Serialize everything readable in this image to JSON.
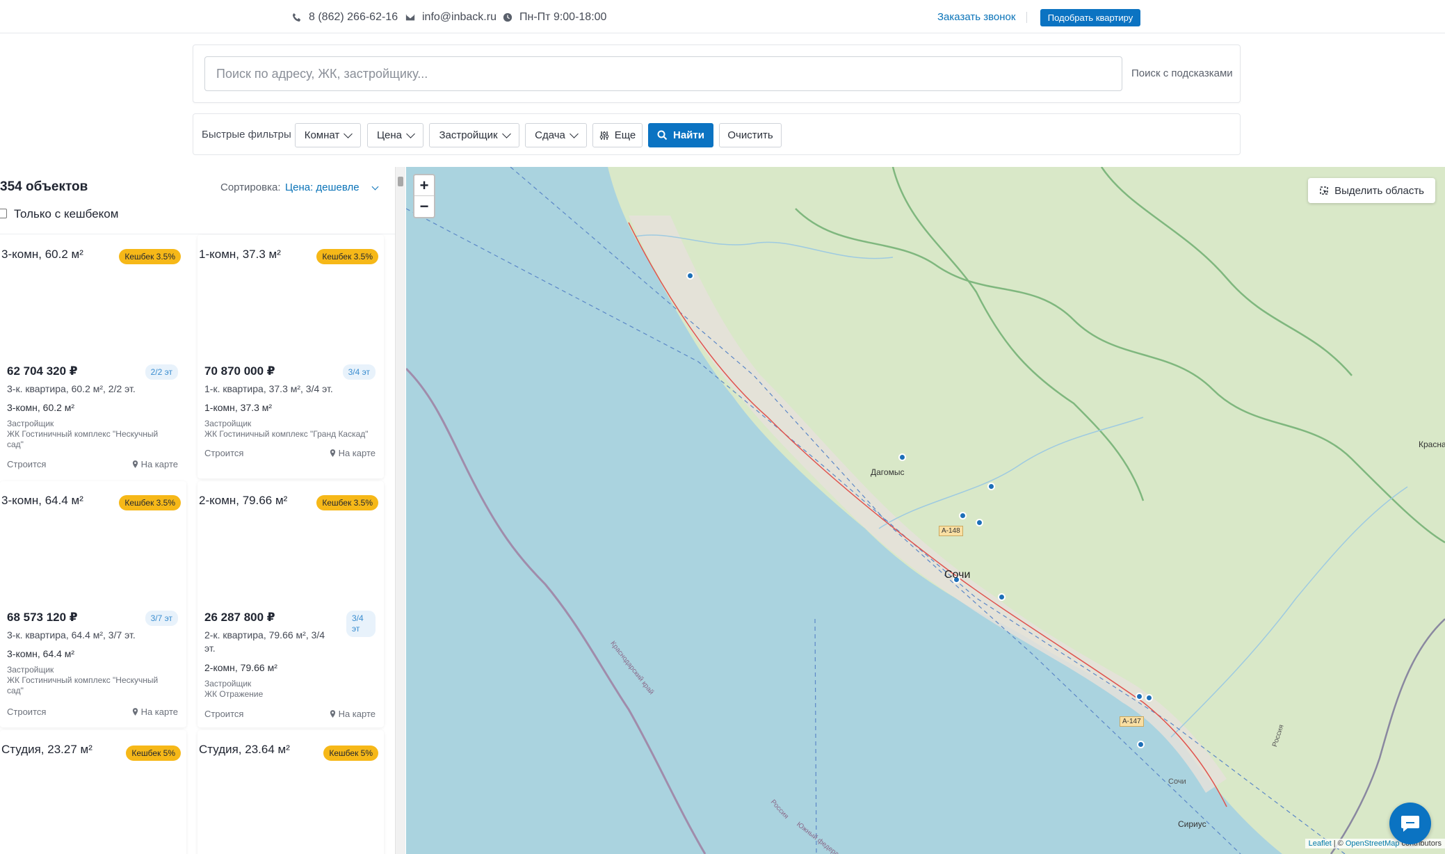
{
  "topbar": {
    "phone": "8 (862) 266-62-16",
    "email": "info@inback.ru",
    "hours": "Пн-Пт 9:00-18:00",
    "callback": "Заказать звонок",
    "cta": "Подобрать квартиру"
  },
  "search": {
    "placeholder": "Поиск по адресу, ЖК, застройщику...",
    "hint": "Поиск с подсказками"
  },
  "filters": {
    "label": "Быстрые фильтры",
    "rooms": "Комнат",
    "price": "Цена",
    "developer": "Застройщик",
    "delivery": "Сдача",
    "more": "Еще",
    "find": "Найти",
    "clear": "Очистить"
  },
  "list": {
    "count": "354 объектов",
    "sort_label": "Сортировка:",
    "sort_value": "Цена: дешевле",
    "cashback_only": "Только с кешбеком",
    "on_map": "На карте",
    "developer_label": "Застройщик",
    "cards": [
      {
        "title": "3-комн, 60.2 м²",
        "badge": "Кешбек 3.5%",
        "price": "62 704 320 ₽",
        "floor": "2/2 эт",
        "desc": "3-к. квартира, 60.2 м², 2/2 эт.",
        "sub": "3-комн, 60.2 м²",
        "complex": "ЖК Гостиничный комплекс \"Нескучный сад\"",
        "status": "Строится"
      },
      {
        "title": "1-комн, 37.3 м²",
        "badge": "Кешбек 3.5%",
        "price": "70 870 000 ₽",
        "floor": "3/4 эт",
        "desc": "1-к. квартира, 37.3 м², 3/4 эт.",
        "sub": "1-комн, 37.3 м²",
        "complex": "ЖК Гостиничный комплекс \"Гранд Каскад\"",
        "status": "Строится"
      },
      {
        "title": "3-комн, 64.4 м²",
        "badge": "Кешбек 3.5%",
        "price": "68 573 120 ₽",
        "floor": "3/7 эт",
        "desc": "3-к. квартира, 64.4 м², 3/7 эт.",
        "sub": "3-комн, 64.4 м²",
        "complex": "ЖК Гостиничный комплекс \"Нескучный сад\"",
        "status": "Строится"
      },
      {
        "title": "2-комн, 79.66 м²",
        "badge": "Кешбек 3.5%",
        "price": "26 287 800 ₽",
        "floor": "3/4 эт",
        "desc": "2-к. квартира, 79.66 м², 3/4 эт.",
        "sub": "2-комн, 79.66 м²",
        "complex": "ЖК Отражение",
        "status": "Строится"
      },
      {
        "title": "Студия, 23.27 м²",
        "badge": "Кешбек 5%"
      },
      {
        "title": "Студия, 23.64 м²",
        "badge": "Кешбек 5%"
      }
    ]
  },
  "map": {
    "zoom_in": "+",
    "zoom_out": "−",
    "select_area": "Выделить область",
    "labels": {
      "dagomys": "Дагомыс",
      "sochi": "Сочи",
      "sirius": "Сириус",
      "sochi_airport": "Сочи",
      "krasnaya": "Красна",
      "road_a148": "А-148",
      "road_a147": "А-147",
      "kray": "Краснодарский край",
      "russia": "Россия",
      "fed_district": "Южный федерал",
      "russia_border": "Россия"
    },
    "attribution_leaflet": "Leaflet",
    "attribution_osm": "OpenStreetMap",
    "attribution_sep": " | © ",
    "attribution_tail": " contributors"
  },
  "colors": {
    "accent": "#0b73c2",
    "cashback": "#f6b818",
    "sea": "#aad3df",
    "land": "#d9e8c8"
  }
}
